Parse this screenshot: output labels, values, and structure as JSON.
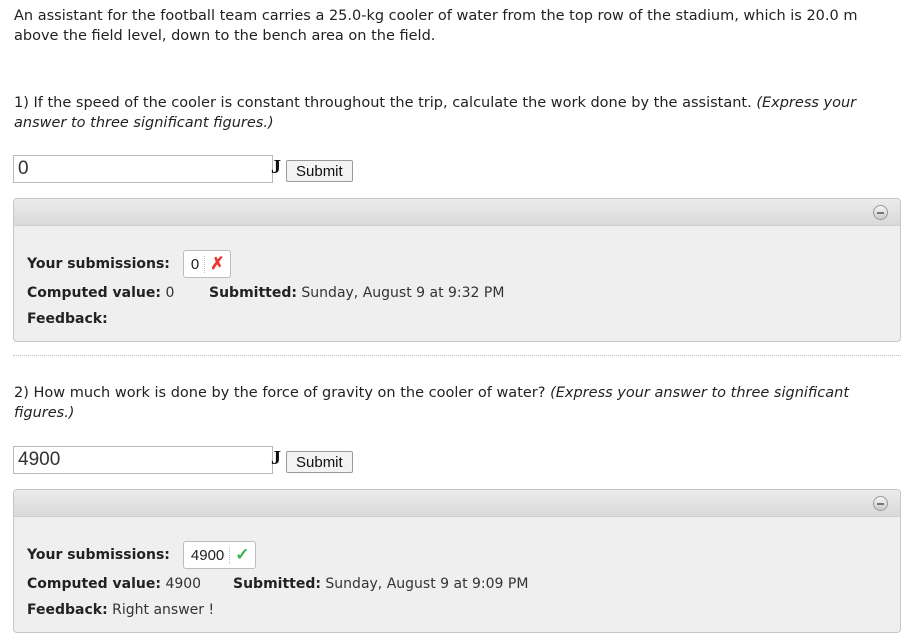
{
  "intro": "An assistant for the football team carries a 25.0-kg cooler of water from the top row of the stadium, which is 20.0 m above the field level, down to the bench area on the field.",
  "questions": [
    {
      "number": "1)",
      "text": "If the speed of the cooler is constant throughout the trip, calculate the work done by the assistant.",
      "hint": "(Express your answer to three significant figures.)",
      "input_value": "0",
      "unit": "J",
      "submit_label": "Submit",
      "submissions_label": "Your submissions:",
      "submission_value": "0",
      "submission_status": "wrong",
      "computed_label": "Computed value:",
      "computed_value": "0",
      "submitted_label": "Submitted:",
      "submitted_value": "Sunday, August 9 at 9:32 PM",
      "feedback_label": "Feedback:",
      "feedback_value": ""
    },
    {
      "number": "2)",
      "text": "How much work is done by the force of gravity on the cooler of water?",
      "hint": "(Express your answer to three significant figures.)",
      "input_value": "4900",
      "unit": "J",
      "submit_label": "Submit",
      "submissions_label": "Your submissions:",
      "submission_value": "4900",
      "submission_status": "correct",
      "computed_label": "Computed value:",
      "computed_value": "4900",
      "submitted_label": "Submitted:",
      "submitted_value": "Sunday, August 9 at 9:09 PM",
      "feedback_label": "Feedback:",
      "feedback_value": "Right answer !"
    }
  ],
  "icons": {
    "wrong": "✗ (red cross)",
    "correct": "✓ (green check)",
    "collapse": "minus-circle-icon"
  },
  "colors": {
    "wrong": "#ee3333",
    "correct": "#3bb54a"
  }
}
